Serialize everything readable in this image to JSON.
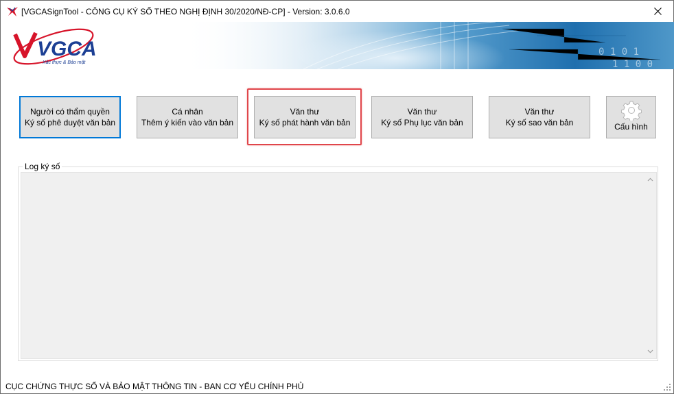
{
  "window": {
    "title": "[VGCASignTool - CÔNG CỤ KÝ SỐ THEO NGHỊ ĐỊNH 30/2020/NĐ-CP] - Version: 3.0.6.0"
  },
  "logo": {
    "text": "VGCA",
    "tagline": "Xác thực & Bảo mật"
  },
  "buttons": [
    {
      "line1": "Người có thẩm quyền",
      "line2": "Ký số phê duyệt văn bản"
    },
    {
      "line1": "Cá nhân",
      "line2": "Thêm ý kiến vào văn bản"
    },
    {
      "line1": "Văn thư",
      "line2": "Ký số phát hành văn bản"
    },
    {
      "line1": "Văn thư",
      "line2": "Ký số Phụ lục văn bản"
    },
    {
      "line1": "Văn thư",
      "line2": "Ký số sao văn bản"
    }
  ],
  "config_button": {
    "label": "Cấu hình"
  },
  "log": {
    "label": "Log ký số",
    "content": ""
  },
  "status_bar": {
    "text": "CỤC CHỨNG THỰC SỐ VÀ BẢO MẬT THÔNG TIN - BAN CƠ YẾU CHÍNH PHỦ"
  },
  "colors": {
    "accent": "#0078d7",
    "highlight": "#e0464b",
    "logo_red": "#d7142a",
    "logo_blue": "#1c3f94",
    "banner_blue": "#2f7fb9"
  },
  "icons": {
    "app": "vgca-sign-icon",
    "close": "close-icon",
    "config": "gear-icon"
  }
}
